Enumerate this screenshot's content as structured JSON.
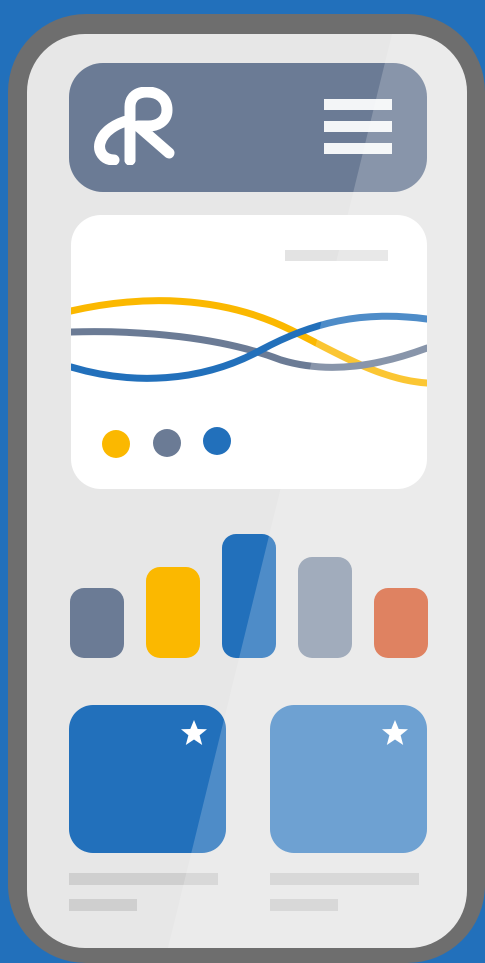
{
  "colors": {
    "background": "#2270BB",
    "phone_frame": "#6E6E6E",
    "screen": "#E7E7E7",
    "header": "#6B7B95",
    "yellow": "#FBB800",
    "slate": "#6B7B95",
    "blue": "#2270BB",
    "light_slate": "#8A98AC",
    "orange": "#D8633A",
    "light_blue": "#4A8AC7",
    "placeholder_gray": "#CFCFCF"
  },
  "icons": {
    "logo": "stylized-r-logo-icon",
    "menu": "hamburger-menu-icon",
    "favorite": "star-icon"
  },
  "chart_card": {
    "wave_series_colors": [
      "#FBB800",
      "#6B7B95",
      "#2270BB"
    ],
    "legend_dots": [
      "#FBB800",
      "#6B7B95",
      "#2270BB"
    ]
  },
  "bars": {
    "colors": [
      "#6B7B95",
      "#FBB800",
      "#2270BB",
      "#8A98AC",
      "#D8633A"
    ],
    "relative_heights": [
      0.56,
      0.74,
      1.0,
      0.8,
      0.56
    ]
  },
  "tiles": [
    {
      "color": "#2270BB",
      "icon": "star-icon"
    },
    {
      "color": "#4A8AC7",
      "icon": "star-icon"
    }
  ]
}
